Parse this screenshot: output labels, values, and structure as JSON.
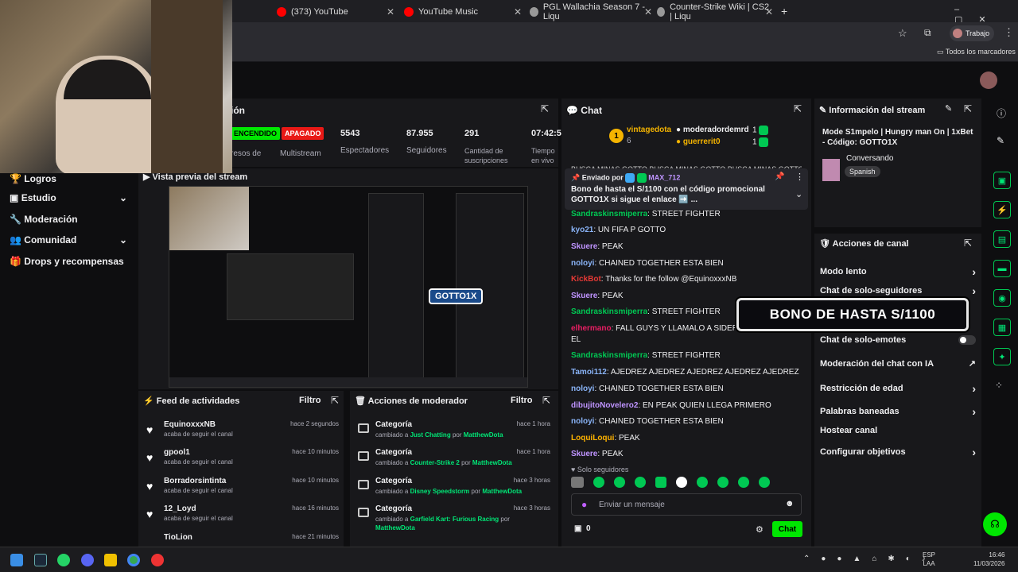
{
  "browser": {
    "tabs": [
      {
        "label": "(373) YouTube",
        "color": "#ff0000"
      },
      {
        "label": "YouTube Music",
        "color": "#ff0000"
      },
      {
        "label": "PGL Wallachia Season 7 - Liqu",
        "color": "#999999"
      },
      {
        "label": "Counter-Strike Wiki | CS2 | Liqu",
        "color": "#999999"
      }
    ],
    "profile": "Trabajo",
    "bookmarks": "Todos los marcadores"
  },
  "sidebar": {
    "items": [
      {
        "label": "Logros",
        "icon": "trophy-icon"
      },
      {
        "label": "Estudio",
        "icon": "film-icon"
      },
      {
        "label": "Moderación",
        "icon": "wrench-icon"
      },
      {
        "label": "Comunidad",
        "icon": "people-icon"
      },
      {
        "label": "Drops y recompensas",
        "icon": "gift-icon"
      }
    ]
  },
  "stats": {
    "title_partial": "ión",
    "live_badge": "ENCENDIDO",
    "multistream_badge": "APAGADO",
    "multistream_label": "Multistream",
    "revenue_partial": "resos de",
    "viewers": "5543",
    "viewers_label": "Espectadores",
    "followers": "87.955",
    "followers_label": "Seguidores",
    "subs": "291",
    "subs_label": "Cantidad de suscripciones",
    "time": "07:42:5",
    "time_label": "Tiempo en vivo"
  },
  "preview": {
    "title": "Vista previa del stream",
    "overlay": "GOTTO1X"
  },
  "feed": {
    "title": "Feed de actividades",
    "filter": "Filtro",
    "items": [
      {
        "name": "EquinoxxxNB",
        "action": "acaba de seguir el canal",
        "time": "hace 2 segundos"
      },
      {
        "name": "gpool1",
        "action": "acaba de seguir el canal",
        "time": "hace 10 minutos"
      },
      {
        "name": "Borradorsintinta",
        "action": "acaba de seguir el canal",
        "time": "hace 10 minutos"
      },
      {
        "name": "12_Loyd",
        "action": "acaba de seguir el canal",
        "time": "hace 16 minutos"
      },
      {
        "name": "TioLion",
        "action": "",
        "time": "hace 21 minutos"
      }
    ]
  },
  "mod": {
    "title": "Acciones de moderador",
    "filter": "Filtro",
    "items": [
      {
        "name": "Categoría",
        "pre": "cambiado a",
        "cat": "Just Chatting",
        "por": "por",
        "user": "MatthewDota",
        "time": "hace 1 hora"
      },
      {
        "name": "Categoría",
        "pre": "cambiado a",
        "cat": "Counter-Strike 2",
        "por": "por",
        "user": "MatthewDota",
        "time": "hace 1 hora"
      },
      {
        "name": "Categoría",
        "pre": "cambiado a",
        "cat": "Disney Speedstorm",
        "por": "por",
        "user": "MatthewDota",
        "time": "hace 3 horas"
      },
      {
        "name": "Categoría",
        "pre": "cambiado a",
        "cat": "Garfield Kart: Furious Racing",
        "por": "por",
        "user": "MatthewDota",
        "time": "hace 3 horas"
      }
    ]
  },
  "chat": {
    "title": "Chat",
    "top": [
      {
        "name": "vintagedota",
        "count": "6",
        "rank": "1"
      },
      {
        "name": "moderadordemrd",
        "count": "1"
      },
      {
        "name": "guerrerit0",
        "count": "1"
      }
    ],
    "scrolled": "BUSCA MINAS GOTTO BUSCA MINAS GOTTO BUSCA MINAS GOTTO",
    "pinned_by_label": "Enviado por",
    "pinned_by": "MAX_712",
    "pinned_text": "Bono de hasta el S/1100 con el código promocional GOTTO1X si sigue el enlace ➡️ ...",
    "messages": [
      {
        "user": "Sandraskinsmiperra",
        "color": "#00c853",
        "text": "STREET FIGHTER"
      },
      {
        "user": "kyo21",
        "color": "#8ab4f8",
        "text": "UN FIFA P GOTTO"
      },
      {
        "user": "Skuere",
        "color": "#bf94ff",
        "text": "PEAK"
      },
      {
        "user": "noloyi",
        "color": "#8ab4f8",
        "text": "CHAINED TOGETHER ESTA BIEN"
      },
      {
        "user": "KickBot",
        "color": "#e53935",
        "text": "Thanks for the follow @EquinoxxxNB"
      },
      {
        "user": "Skuere",
        "color": "#bf94ff",
        "text": "PEAK"
      },
      {
        "user": "Sandraskinsmiperra",
        "color": "#00c853",
        "text": "STREET FIGHTER"
      },
      {
        "user": "elhermano",
        "color": "#e91e63",
        "text": "FALL GUYS Y LLAMALO A SIDERAL O"
      },
      {
        "user": "",
        "color": "#efeff1",
        "text": "EL"
      },
      {
        "user": "Sandraskinsmiperra",
        "color": "#00c853",
        "text": "STREET FIGHTER"
      },
      {
        "user": "Tamoi112",
        "color": "#8ab4f8",
        "text": "AJEDREZ AJEDREZ AJEDREZ AJEDREZ AJEDREZ"
      },
      {
        "user": "noloyi",
        "color": "#8ab4f8",
        "text": "CHAINED TOGETHER ESTA BIEN"
      },
      {
        "user": "dibujitoNovelero2",
        "color": "#bf94ff",
        "text": "EN PEAK QUIEN LLEGA PRIMERO"
      },
      {
        "user": "noloyi",
        "color": "#8ab4f8",
        "text": "CHAINED TOGETHER ESTA BIEN"
      },
      {
        "user": "LoquiLoqui",
        "color": "#ffb300",
        "text": "PEAK"
      },
      {
        "user": "Skuere",
        "color": "#bf94ff",
        "text": "PEAK"
      }
    ],
    "followers_only": "Solo seguidores",
    "input_placeholder": "Enviar un mensaje",
    "points": "0",
    "send": "Chat"
  },
  "info": {
    "title": "Información del stream",
    "stream_title": "Mode S1mpelo | Hungry man On | 1xBet - Código: GOTTO1X",
    "category": "Conversando",
    "language": "Spanish"
  },
  "actions": {
    "title": "Acciones de canal",
    "items": [
      {
        "label": "Modo lento",
        "type": "chevron"
      },
      {
        "label": "Chat de solo-seguidores",
        "type": "chevron"
      },
      {
        "label": "Chat de solo-emotes",
        "type": "toggle"
      },
      {
        "label": "Moderación del chat con IA",
        "type": "external"
      },
      {
        "label": "Restricción de edad",
        "type": "chevron"
      },
      {
        "label": "Palabras baneadas",
        "type": "chevron"
      },
      {
        "label": "Hostear canal",
        "type": "none"
      },
      {
        "label": "Configurar objetivos",
        "type": "chevron"
      }
    ]
  },
  "promo": "BONO DE HASTA S/1100",
  "tray": {
    "lang": "ESP",
    "layout": "LAA",
    "time": "16:46",
    "date": "11/03/2026"
  },
  "colors": {
    "accent": "#00e701",
    "bg": "#0e0e10",
    "panel": "#18181b",
    "danger": "#e91916"
  }
}
